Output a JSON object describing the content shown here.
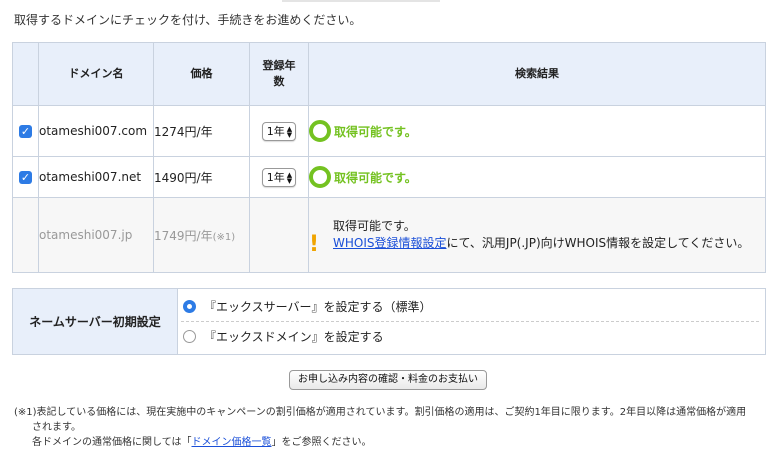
{
  "instruction": "取得するドメインにチェックを付け、手続きをお進めください。",
  "table": {
    "headers": {
      "domain": "ドメイン名",
      "price": "価格",
      "years_line1": "登録年",
      "years_line2": "数",
      "result": "検索結果"
    },
    "rows": [
      {
        "checked": true,
        "domain": "otameshi007.com",
        "price": "1274円/年",
        "years": "1年",
        "result": "取得可能です。"
      },
      {
        "checked": true,
        "domain": "otameshi007.net",
        "price": "1490円/年",
        "years": "1年",
        "result": "取得可能です。"
      },
      {
        "checked": false,
        "domain": "otameshi007.jp",
        "price": "1749円/年",
        "price_note": "(※1)",
        "result_line1": "取得可能です。",
        "whois_link": "WHOIS登録情報設定",
        "result_after_link": "にて、汎用JP(.JP)向けWHOIS情報を設定してください。"
      }
    ]
  },
  "nameserver": {
    "label": "ネームサーバー初期設定",
    "options": [
      {
        "label": "『エックスサーバー』を設定する（標準）",
        "selected": true
      },
      {
        "label": "『エックスドメイン』を設定する",
        "selected": false
      }
    ]
  },
  "submit_label": "お申し込み内容の確認・料金のお支払い",
  "footnote": {
    "line1": "(※1)表記している価格には、現在実施中のキャンペーンの割引価格が適用されています。割引価格の適用は、ご契約1年目に限ります。2年目以降は通常価格が適用",
    "line2": "されます。",
    "line3_before": "各ドメインの通常価格に関しては「",
    "line3_link": "ドメイン価格一覧",
    "line3_after": "」をご参照ください。"
  },
  "colors": {
    "accent_blue": "#2d7be5",
    "ok_green": "#74c221",
    "warn_orange": "#f0a400",
    "header_bg": "#e8effa"
  },
  "icons": {
    "check": "checkbox-checked-icon",
    "ok": "ok-ring-icon",
    "warn": "exclamation-icon",
    "select": "updown-arrow-icon"
  }
}
